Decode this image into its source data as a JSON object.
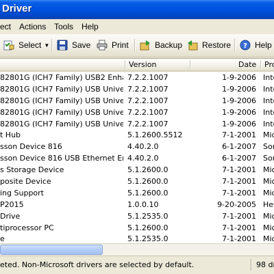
{
  "window": {
    "title": "Driver"
  },
  "menu": [
    "ect",
    "Actions",
    "Tools",
    "Help"
  ],
  "toolbar": {
    "select_label": "Select",
    "save_label": "Save",
    "print_label": "Print",
    "backup_label": "Backup",
    "restore_label": "Restore",
    "help_label": "Help"
  },
  "columns": {
    "version": "Version",
    "date": "Date",
    "provider": "Pro"
  },
  "rows": [
    {
      "name": "82801G (ICH7 Family) USB2 Enhanc...",
      "version": "7.2.2.1007",
      "date": "1-9-2006",
      "provider": "Inte"
    },
    {
      "name": "82801G (ICH7 Family) USB Universa...",
      "version": "7.2.2.1007",
      "date": "1-9-2006",
      "provider": "Inte"
    },
    {
      "name": "82801G (ICH7 Family) USB Universa...",
      "version": "7.2.2.1007",
      "date": "1-9-2006",
      "provider": "Inte"
    },
    {
      "name": "82801G (ICH7 Family) USB Universa...",
      "version": "7.2.2.1007",
      "date": "1-9-2006",
      "provider": "Inte"
    },
    {
      "name": "82801G (ICH7 Family) USB Universa...",
      "version": "7.2.2.1007",
      "date": "1-9-2006",
      "provider": "Inte"
    },
    {
      "name": "t Hub",
      "version": "5.1.2600.5512",
      "date": "7-1-2001",
      "provider": "Micr"
    },
    {
      "name": "sson Device 816",
      "version": "4.40.2.0",
      "date": "6-1-2007",
      "provider": "Son"
    },
    {
      "name": "sson Device 816 USB Ethernet Emu...",
      "version": "4.40.2.0",
      "date": "6-1-2007",
      "provider": "Son"
    },
    {
      "name": "s Storage Device",
      "version": "5.1.2600.0",
      "date": "7-1-2001",
      "provider": "Micr"
    },
    {
      "name": "posite Device",
      "version": "5.1.2600.0",
      "date": "7-1-2001",
      "provider": "Micr"
    },
    {
      "name": "ing Support",
      "version": "5.1.2600.0",
      "date": "7-1-2001",
      "provider": "Micr"
    },
    {
      "name": "P2015",
      "version": "1.0.0.10",
      "date": "9-20-2005",
      "provider": "Hew"
    },
    {
      "name": "Drive",
      "version": "5.1.2535.0",
      "date": "7-1-2001",
      "provider": "Micr"
    },
    {
      "name": "tiprocessor PC",
      "version": "5.1.2600.0",
      "date": "7-1-2001",
      "provider": "Micr"
    },
    {
      "name": "e",
      "version": "5.1.2535.0",
      "date": "7-1-2001",
      "provider": "Micr"
    }
  ],
  "status": {
    "message": "eted. Non-Microsoft drivers are selected by default.",
    "count": "98 dr"
  },
  "colors": {
    "titlebar": "#0054e3",
    "selection_thumb": "#b5cdf7"
  }
}
